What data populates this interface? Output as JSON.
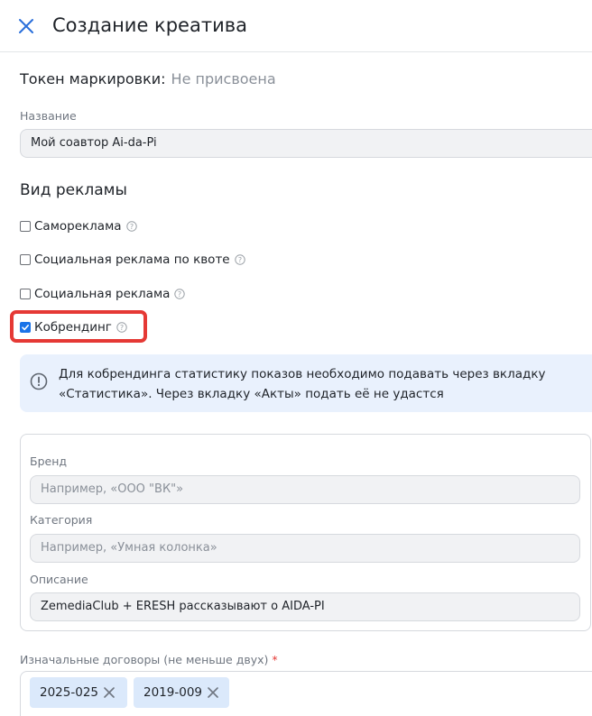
{
  "header": {
    "title": "Создание креатива"
  },
  "token": {
    "label": "Токен маркировки:",
    "value": "Не присвоена"
  },
  "name_field": {
    "label": "Название",
    "value": "Мой соавтор Ai-da-Pi"
  },
  "ad_type": {
    "title": "Вид рекламы",
    "options": [
      {
        "label": "Самореклама",
        "checked": false
      },
      {
        "label": "Социальная реклама по квоте",
        "checked": false
      },
      {
        "label": "Социальная реклама",
        "checked": false
      },
      {
        "label": "Кобрендинг",
        "checked": true
      }
    ]
  },
  "alert": {
    "text": "Для кобрендинга статистику показов необходимо подавать через вкладку «Статистика». Через вкладку «Акты» подать её не удастся"
  },
  "brand_section": {
    "brand": {
      "label": "Бренд",
      "placeholder": "Например, «ООО \"ВК\"»"
    },
    "category": {
      "label": "Категория",
      "placeholder": "Например, «Умная колонка»"
    },
    "description": {
      "label": "Описание",
      "value": "ZemediaClub + ERESH рассказывают о AIDA-PI"
    }
  },
  "contracts": {
    "label": "Изначальные договоры (не меньше двух)",
    "required_mark": "*",
    "chips": [
      "2025-025",
      "2019-009"
    ]
  },
  "colors": {
    "accent": "#1a73e8",
    "highlight": "#e53935",
    "alert_bg": "#e9f1fd",
    "chip_bg": "#dbe9fb"
  }
}
